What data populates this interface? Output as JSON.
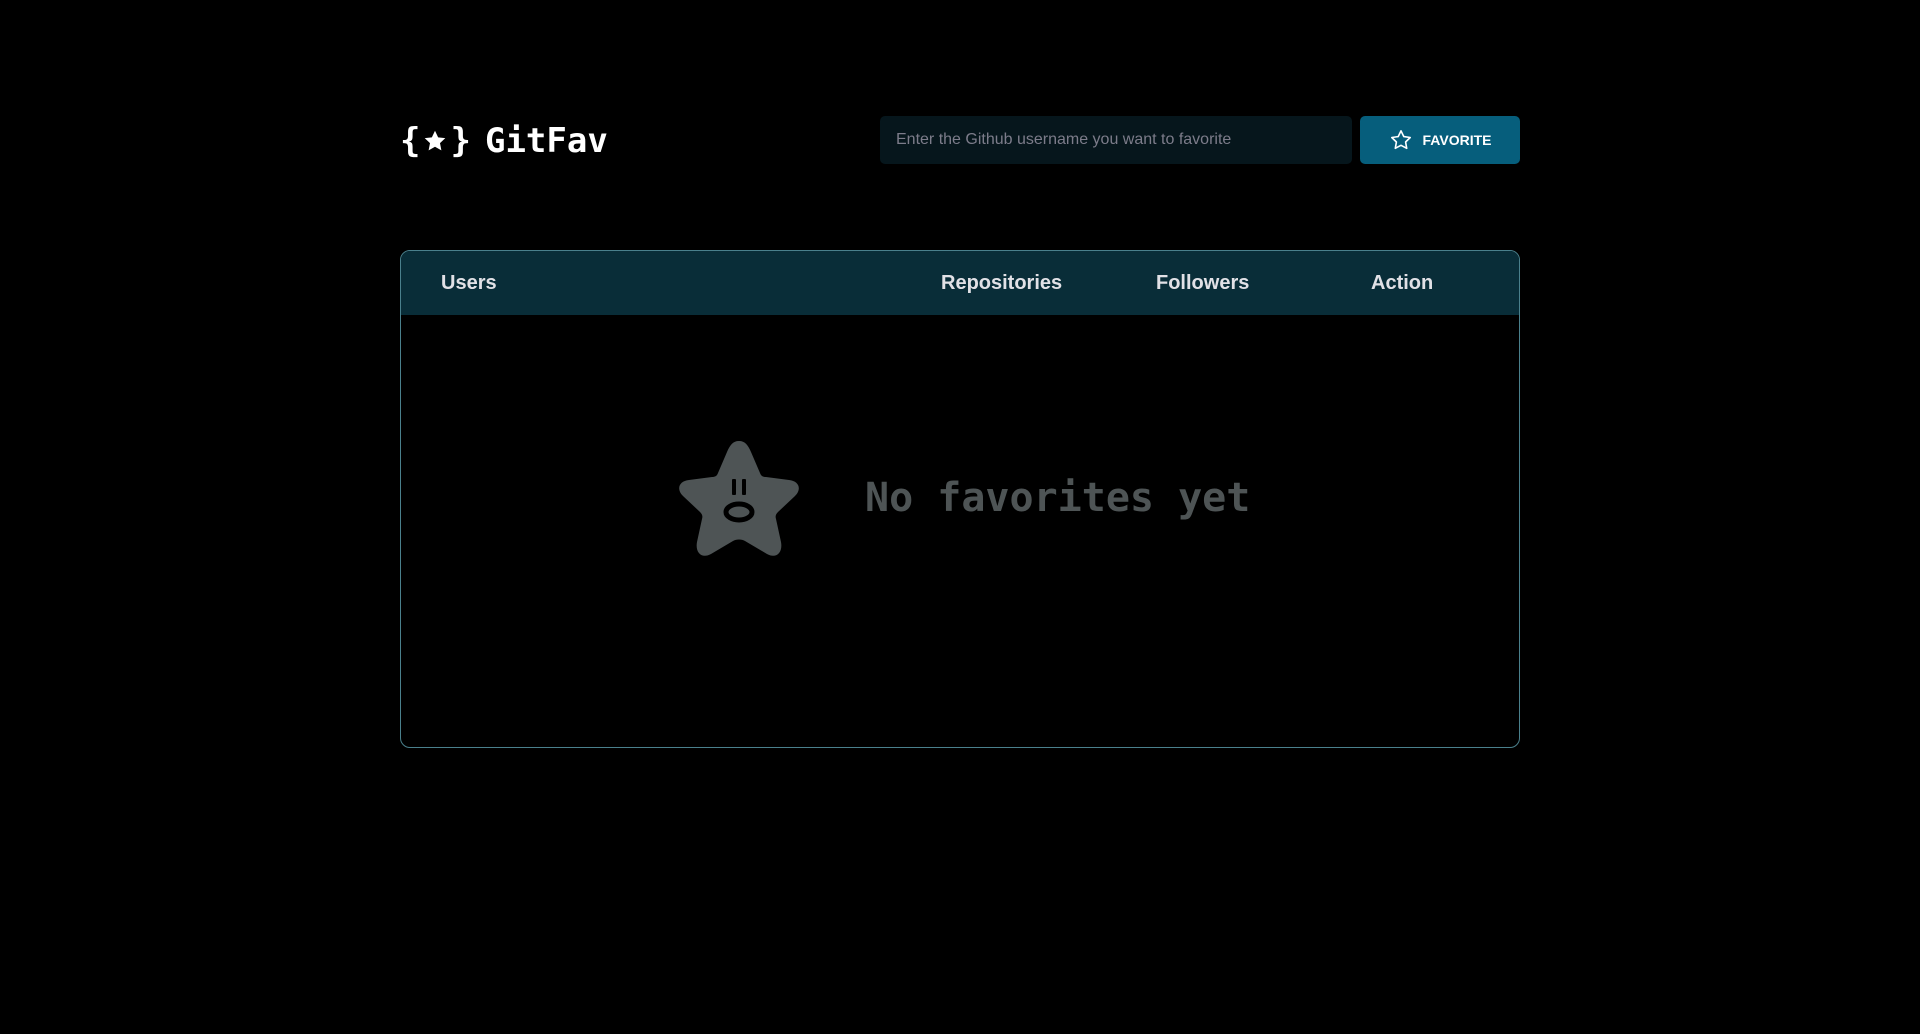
{
  "app": {
    "logo_text": "GitFav"
  },
  "search": {
    "placeholder": "Enter the Github username you want to favorite",
    "value": "",
    "button_label": "FAVORITE",
    "button_icon": "star-outline-icon"
  },
  "table": {
    "headers": [
      "Users",
      "Repositories",
      "Followers",
      "Action"
    ],
    "rows": []
  },
  "empty_state": {
    "icon": "surprised-star-icon",
    "message": "No favorites yet"
  },
  "colors": {
    "background": "#000000",
    "table_header": "#092d38",
    "table_border": "#4a808c",
    "button": "#065e7c",
    "input_bg": "#06161c",
    "empty_text": "#4e5455",
    "empty_icon": "#4e5455"
  }
}
